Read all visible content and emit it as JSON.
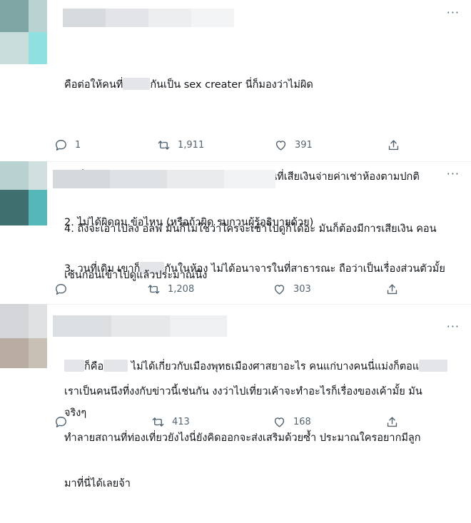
{
  "tweets": [
    {
      "more": "···",
      "lines": [
        {
          "parts": [
            "คือต่อให้คนที่",
            "",
            "กันเป็น sex creater นี่ก็มองว่าไม่ผิด"
          ]
        },
        {
          "parts": [
            ""
          ]
        },
        {
          "parts": [
            "1. ที่พักก็ไม่ได้มีกฎห้ามว่าห้ามถ่าย จขคก็เป็นคนที่เสียเงินจ่ายค่าเช่าห้องตามปกติ"
          ]
        },
        {
          "parts": [
            "2. ไม่ได้ผิดกม.ข้อไหน (หรือถ้าผิด รบกวนผู้รู้อธิบายด้วย)"
          ]
        },
        {
          "parts": [
            "3. วนที่เดิม เขาก็",
            "",
            "กันในห้อง ไม่ได้อนาจารในที่สาธารณะ ถือว่าเป็นเรื่องส่วนตัวมั้ย"
          ]
        }
      ],
      "reply_count": "1",
      "retweet_count": "1,911",
      "like_count": "391"
    },
    {
      "more": "···",
      "lines": [
        {
          "parts": [
            "4. ถึงจะเอาไปลง อลฟ มันก็ไม่ใช่ว่าใครจะเข้าไปดูก็ได้อะ มันก็ต้องมีการเสียเงิน คอน"
          ]
        },
        {
          "parts": [
            "เซ้นก่อนเข้าไปดูแล้วประมาณนึง"
          ]
        },
        {
          "parts": [
            ""
          ]
        },
        {
          "parts": [
            "",
            "ก็คือ",
            "",
            " ไม่ได้เกี่ยวกับเมืองพุทธเมืองศาสยาอะไร คนแก่บางคนนี่แม่งก็ตอแ",
            ""
          ]
        },
        {
          "parts": [
            "จริงๆ"
          ]
        }
      ],
      "reply_count": "",
      "retweet_count": "1,208",
      "like_count": "303"
    },
    {
      "more": "···",
      "lines": [
        {
          "parts": [
            "เราเป็นคนนึงที่งงกับข่าวนี้เช่นกัน งงว่าไปเที่ยวเค้าจะทำอะไรก็เรื่องของเค้ามั้ย มัน"
          ]
        },
        {
          "parts": [
            "ทำลายสถานที่ท่องเที่ยวยังไงนี่ยังคิดออกจะส่งเสริมด้วยซ้ำ ประมาณใครอยากมีลูก"
          ]
        },
        {
          "parts": [
            "มาที่นี่ได้เลยจ้า"
          ]
        }
      ],
      "reply_count": "",
      "retweet_count": "413",
      "like_count": "168"
    }
  ],
  "colors": {
    "text": "#0f1419",
    "muted": "#536471",
    "blur": "#e3e5e8",
    "divider": "#eff3f4"
  },
  "icons": [
    "reply-icon",
    "retweet-icon",
    "like-icon",
    "share-icon",
    "more-icon"
  ]
}
